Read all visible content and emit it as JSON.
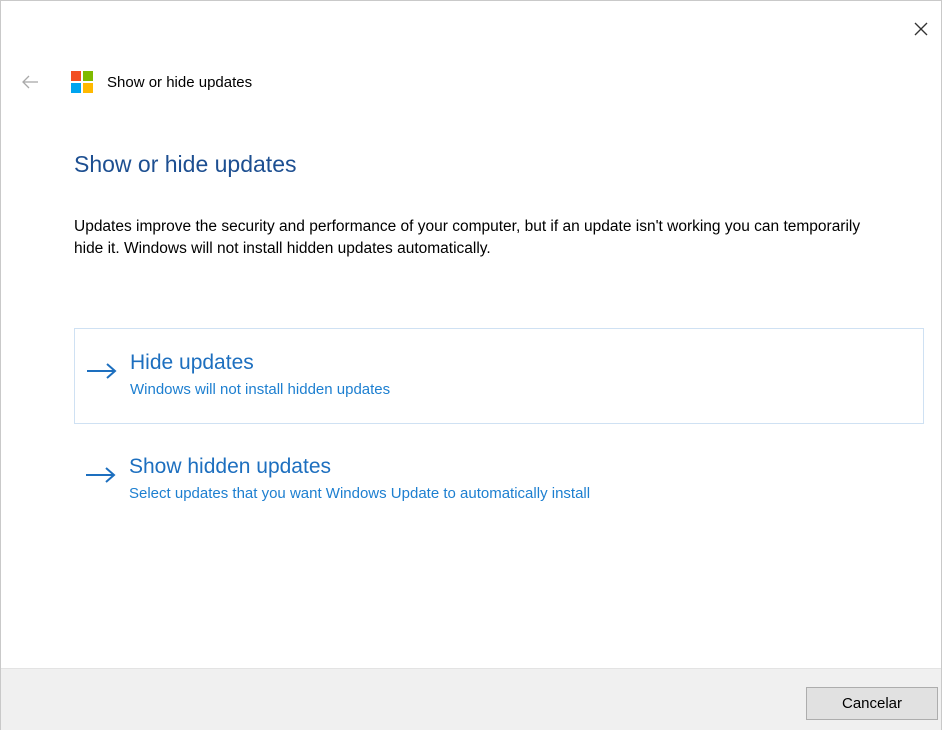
{
  "window": {
    "title": "Show or hide updates",
    "close_icon": "close-icon",
    "back_icon": "back-arrow-icon",
    "app_icon": "windows-logo-icon",
    "logo_colors": [
      "#f25022",
      "#7fba00",
      "#00a4ef",
      "#ffb900"
    ]
  },
  "page": {
    "title": "Show or hide updates",
    "description": "Updates improve the security and performance of your computer, but if an update isn't working you can temporarily hide it. Windows will not install hidden updates automatically."
  },
  "options": [
    {
      "title": "Hide updates",
      "subtitle": "Windows will not install hidden updates",
      "icon": "arrow-right-icon"
    },
    {
      "title": "Show hidden updates",
      "subtitle": "Select updates that you want Windows Update to automatically install",
      "icon": "arrow-right-icon"
    }
  ],
  "footer": {
    "cancel_label": "Cancelar"
  },
  "colors": {
    "title_blue": "#1d4f91",
    "link_blue": "#1d6fbf",
    "selected_border": "#cfe1f3",
    "footer_bg": "#f0f0f0"
  }
}
